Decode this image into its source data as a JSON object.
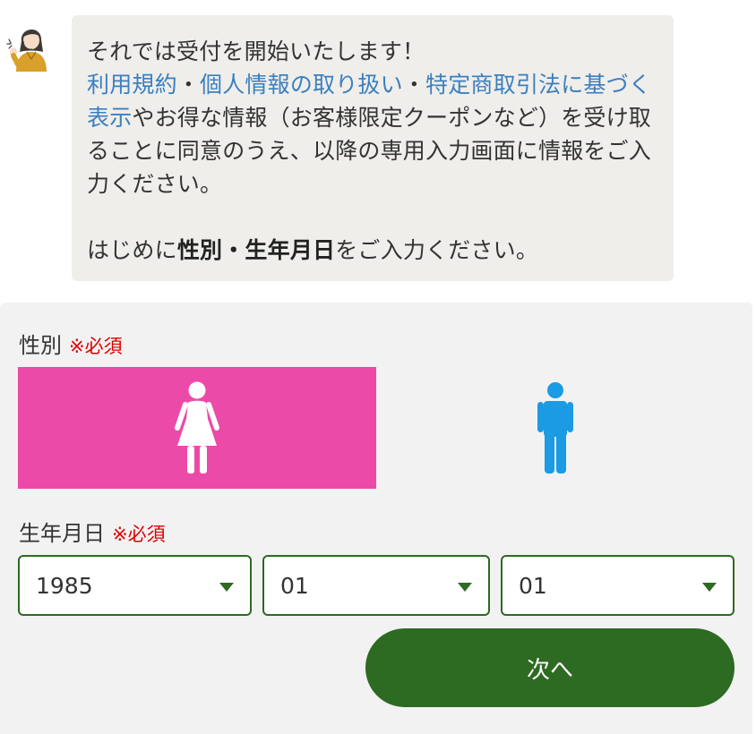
{
  "chat": {
    "line1": "それでは受付を開始いたします！",
    "link_terms": "利用規約",
    "sep1": "・",
    "link_privacy": "個人情報の取り扱い",
    "sep2": "・",
    "link_tokushoho": "特定商取引法に基づく表示",
    "after_links": "やお得な情報（お客様限定クーポンなど）を受け取ることに同意のうえ、以降の専用入力画面に情報をご入力ください。",
    "prompt_prefix": "はじめに",
    "prompt_bold": "性別・生年月日",
    "prompt_suffix": "をご入力ください。"
  },
  "form": {
    "gender": {
      "label": "性別",
      "required": "※必須",
      "selected": "female",
      "options": [
        {
          "value": "female",
          "icon": "female-icon",
          "color": "#ec4aa8"
        },
        {
          "value": "male",
          "icon": "male-icon",
          "color": "#1a9be3"
        }
      ]
    },
    "birthdate": {
      "label": "生年月日",
      "required": "※必須",
      "year": "1985",
      "month": "01",
      "day": "01"
    },
    "next_label": "次へ"
  },
  "colors": {
    "accent_green": "#2d6a22",
    "female_pink": "#ec4aa8",
    "male_blue": "#1a9be3",
    "link_blue": "#3b7fc0",
    "required_red": "#e00000"
  }
}
